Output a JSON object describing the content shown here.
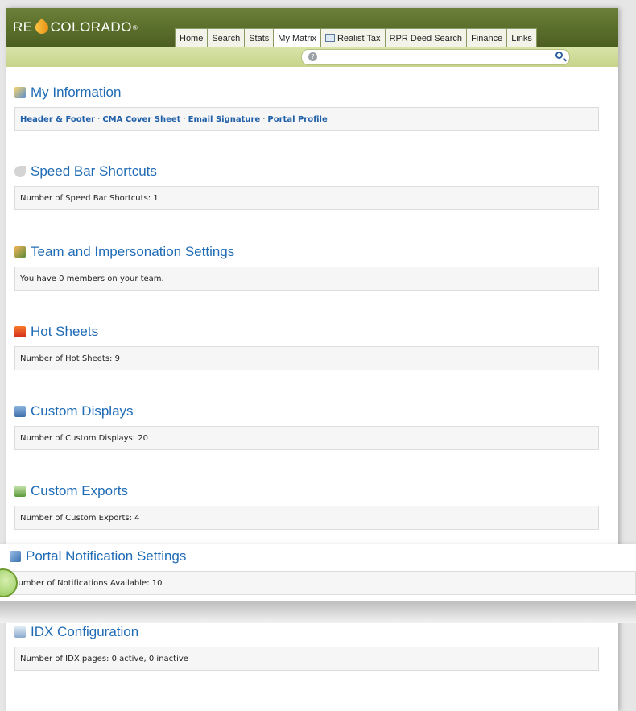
{
  "header": {
    "logo_left": "RE",
    "logo_right": "COLORADO",
    "logo_mark": "®",
    "tabs": [
      {
        "label": "Home"
      },
      {
        "label": "Search"
      },
      {
        "label": "Stats"
      },
      {
        "label": "My Matrix",
        "active": true
      },
      {
        "label": "Realist Tax",
        "icon": "window-icon"
      },
      {
        "label": "RPR Deed Search"
      },
      {
        "label": "Finance"
      },
      {
        "label": "Links"
      }
    ],
    "search": {
      "help_icon": "help-icon",
      "search_icon": "magnifier-icon",
      "value": ""
    }
  },
  "sections": {
    "my_information": {
      "title": "My Information",
      "links": [
        "Header & Footer",
        "CMA Cover Sheet",
        "Email Signature",
        "Portal Profile"
      ],
      "separator": "·"
    },
    "speed_bar": {
      "title": "Speed Bar Shortcuts",
      "text": "Number of Speed Bar Shortcuts: 1"
    },
    "team": {
      "title": "Team and Impersonation Settings",
      "text": "You have 0 members on your team."
    },
    "hot_sheets": {
      "title": "Hot Sheets",
      "text": "Number of Hot Sheets: 9"
    },
    "custom_displays": {
      "title": "Custom Displays",
      "text": "Number of Custom Displays: 20"
    },
    "custom_exports": {
      "title": "Custom Exports",
      "text": "Number of Custom Exports: 4"
    },
    "portal_notifications": {
      "title": "Portal Notification Settings",
      "text": "Number of Notifications Available: 10"
    },
    "idx": {
      "title": "IDX Configuration",
      "text": "Number of IDX pages: 0 active, 0 inactive"
    }
  },
  "colors": {
    "header": "#5a6e2c",
    "subbar": "#cfdb98",
    "title": "#1f6bb5"
  }
}
